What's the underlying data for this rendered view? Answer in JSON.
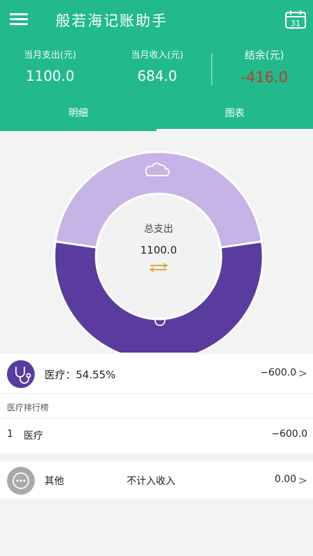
{
  "header": {
    "title": "般若海记账助手",
    "calendar_day": "31",
    "colors": {
      "background": "#22b98c",
      "negative": "#c0392b"
    }
  },
  "summary": {
    "expense_label": "当月支出(元)",
    "expense_value": "1100.0",
    "income_label": "当月收入(元)",
    "income_value": "684.0",
    "balance_label": "结余(元)",
    "balance_value": "-416.0"
  },
  "tabs": [
    {
      "label": "明细",
      "active": false
    },
    {
      "label": "图表",
      "active": true
    }
  ],
  "donut": {
    "center_label": "总支出",
    "center_value": "1100.0",
    "segments": [
      {
        "icon": "cloud-icon",
        "color": "#c6b4e6",
        "fraction": 0.4545
      },
      {
        "icon": "stethoscope-icon",
        "color": "#5a3c9e",
        "fraction": 0.5455
      }
    ]
  },
  "top_category": {
    "icon": "stethoscope-icon",
    "name": "医疗：54.55%",
    "amount": "−600.0"
  },
  "ranking": {
    "title": "医疗排行榜",
    "items": [
      {
        "rank": "1",
        "name": "医疗",
        "amount": "−600.0"
      }
    ]
  },
  "other": {
    "icon": "ellipsis-icon",
    "name": "其他",
    "note": "不计入收入",
    "amount": "0.00"
  },
  "chevron": ">"
}
